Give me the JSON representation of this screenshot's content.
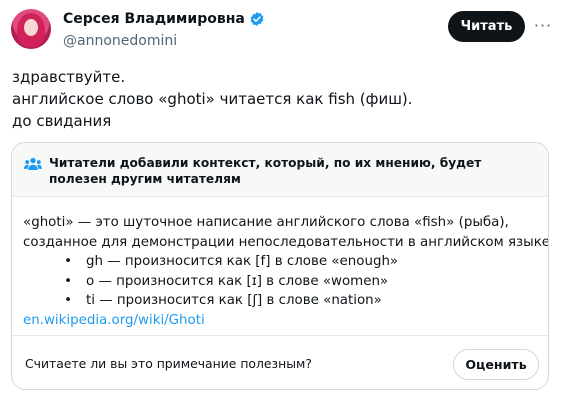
{
  "author": {
    "display_name": "Серсея Владимировна",
    "handle": "@annonedomini"
  },
  "header": {
    "follow_label": "Читать",
    "more_label": "···"
  },
  "tweet": {
    "lines": [
      "здравствуйте.",
      "английское слово «ghoti» читается как fish (фиш).",
      "до свидания"
    ]
  },
  "community_note": {
    "header": "Читатели добавили контекст, который, по их мнению, будет полезен другим читателям",
    "body_lines": [
      "«ghoti» — это шуточное  написание английского слова «fish» (рыба),",
      "созданное для демонстрации непоследовательности  в английском языке"
    ],
    "bullets": [
      "gh — произносится как [f] в слове «enough»",
      "o — произносится как [ɪ] в слове «women»",
      "ti — произносится как [ʃ] в слове «nation»"
    ],
    "link": "en.wikipedia.org/wiki/Ghoti",
    "question": "Считаете ли вы это примечание полезным?",
    "rate_label": "Оценить"
  },
  "colors": {
    "accent": "#1d9bf0",
    "text": "#0f1419",
    "muted": "#536471",
    "note_header_bg": "#f7f9f9"
  }
}
